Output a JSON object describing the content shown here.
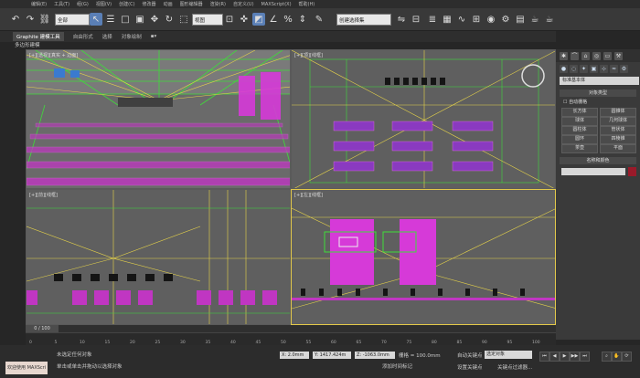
{
  "menu": {
    "items": [
      "编辑(E)",
      "工具(T)",
      "组(G)",
      "视图(V)",
      "创建(C)",
      "修改器",
      "动画",
      "图形编辑器",
      "渲染(R)",
      "自定义(U)",
      "MAXScript(X)",
      "帮助(H)"
    ]
  },
  "toolbar": {
    "selection_filter": "全部",
    "reference_coord": "视图",
    "named_selection": "创建选择集"
  },
  "ribbon": {
    "tabs": [
      "Graphite 建模工具",
      "自由形式",
      "选择",
      "对象绘制"
    ],
    "subtitle": "多边形建模"
  },
  "viewports": {
    "perspective_label": "[+][透视][真实 + 边面]",
    "top_label": "[+][顶][线框]",
    "front_label": "[+][前][线框]",
    "left_label": "[+][左][线框]"
  },
  "command_panel": {
    "dropdown": "标准基本体",
    "object_type_title": "对象类型",
    "autogrid": "自动栅格",
    "buttons": [
      "长方体",
      "圆锥体",
      "球体",
      "几何球体",
      "圆柱体",
      "管状体",
      "圆环",
      "四棱锥",
      "茶壶",
      "平面"
    ],
    "name_color_title": "名称和颜色"
  },
  "timeline": {
    "frame_label": "0 / 100",
    "ticks": [
      "0",
      "5",
      "10",
      "15",
      "20",
      "25",
      "30",
      "35",
      "40",
      "45",
      "50",
      "55",
      "60",
      "65",
      "70",
      "75",
      "80",
      "85",
      "90",
      "95",
      "100"
    ]
  },
  "status": {
    "welcome": "欢迎使用 MAXScri",
    "line1": "未选定任何对象",
    "line2": "单击或单击并拖动以选择对象",
    "x": "X: 2.0mm",
    "y": "Y: 1417.424m",
    "z": "Z: -1063.0mm",
    "grid": "栅格 = 100.0mm",
    "add_time_tag": "添加时间标记",
    "autokey": "自动关键点",
    "selected_objects": "选定对象",
    "set_key": "设置关键点",
    "key_filters": "关键点过滤器..."
  },
  "colors": {
    "background": "#262626",
    "viewport_bg": "#5f5f5f",
    "active_border": "#e3c84a",
    "wire_green": "#3fdc3a",
    "wire_yellow": "#e6d34a",
    "chair_magenta": "#d63ad8"
  }
}
